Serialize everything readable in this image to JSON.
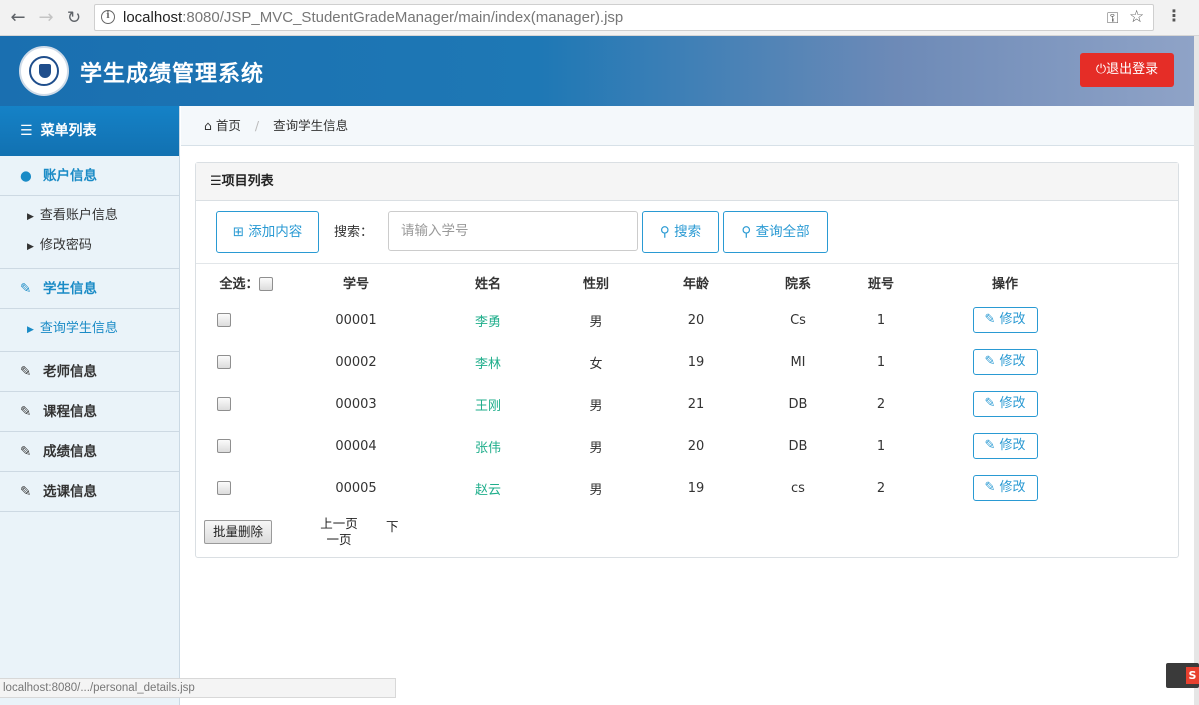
{
  "browser": {
    "url_host": "localhost",
    "url_rest": ":8080/JSP_MVC_StudentGradeManager/main/index(manager).jsp",
    "status_url": "localhost:8080/.../personal_details.jsp"
  },
  "header": {
    "title": "学生成绩管理系统",
    "logout_label": "退出登录"
  },
  "sidebar": {
    "menu_title": "菜单列表",
    "account": {
      "label": "账户信息",
      "items": [
        "查看账户信息",
        "修改密码"
      ]
    },
    "student": {
      "label": "学生信息",
      "items": [
        "查询学生信息"
      ]
    },
    "teacher": {
      "label": "老师信息"
    },
    "course": {
      "label": "课程信息"
    },
    "grade": {
      "label": "成绩信息"
    },
    "selection": {
      "label": "选课信息"
    }
  },
  "breadcrumb": {
    "home": "首页",
    "current": "查询学生信息"
  },
  "panel": {
    "title": "项目列表",
    "add_label": "添加内容",
    "search_label": "搜索：",
    "search_placeholder": "请输入学号",
    "search_button": "搜索",
    "query_all_button": "查询全部",
    "columns": {
      "select_all": "全选：",
      "id": "学号",
      "name": "姓名",
      "gender": "性别",
      "age": "年龄",
      "dept": "院系",
      "class": "班号",
      "ops": "操作"
    },
    "rows": [
      {
        "id": "00001",
        "name": "李勇",
        "gender": "男",
        "age": "20",
        "dept": "Cs",
        "class": "1"
      },
      {
        "id": "00002",
        "name": "李林",
        "gender": "女",
        "age": "19",
        "dept": "MI",
        "class": "1"
      },
      {
        "id": "00003",
        "name": "王刚",
        "gender": "男",
        "age": "21",
        "dept": "DB",
        "class": "2"
      },
      {
        "id": "00004",
        "name": "张伟",
        "gender": "男",
        "age": "20",
        "dept": "DB",
        "class": "1"
      },
      {
        "id": "00005",
        "name": "赵云",
        "gender": "男",
        "age": "19",
        "dept": "cs",
        "class": "2"
      }
    ],
    "edit_label": "修改",
    "batch_delete": "批量删除",
    "prev_page": "上一页",
    "next_page": "下",
    "next_page_suffix": "一页"
  },
  "colors": {
    "accent": "#2a9ad3",
    "logout": "#e52d27",
    "name_link": "#1fae8b"
  }
}
